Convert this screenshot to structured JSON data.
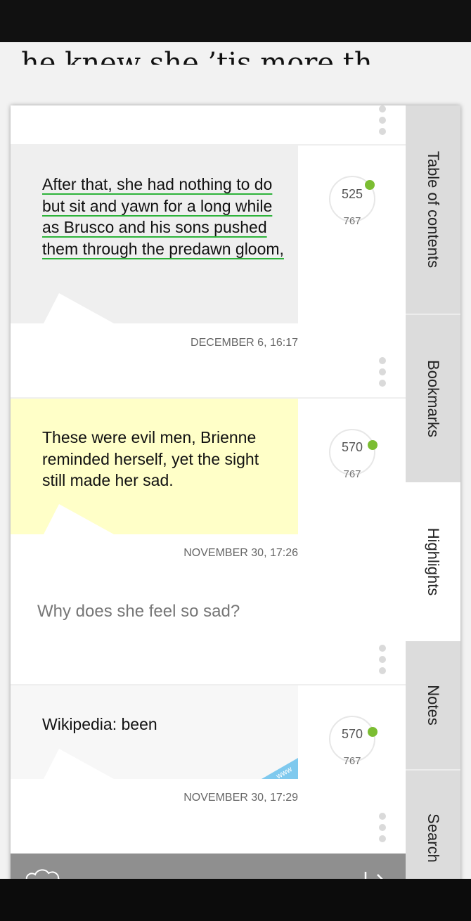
{
  "book_text_behind": "he knew she ’tis more th",
  "highlights": [
    {
      "text": "After that, she had nothing to do but sit and yawn for a long while as Brusco and his sons pushed them through the predawn gloom,",
      "style": "underline",
      "page": "525",
      "total": "767",
      "date": "DECEMBER 6, 16:17"
    },
    {
      "text": "These were evil men, Brienne reminded herself, yet the sight still made her sad.",
      "style": "yellow",
      "page": "570",
      "total": "767",
      "date": "NOVEMBER 30, 17:26",
      "note": "Why does she feel so sad?"
    },
    {
      "text": "Wikipedia: been",
      "style": "wiki",
      "page": "570",
      "total": "767",
      "date": "NOVEMBER 30, 17:29",
      "corner_label": "www"
    }
  ],
  "tabs": [
    {
      "label": "Table of contents",
      "active": false
    },
    {
      "label": "Bookmarks",
      "active": false
    },
    {
      "label": "Highlights",
      "active": true
    },
    {
      "label": "Notes",
      "active": false
    },
    {
      "label": "Search",
      "active": false
    }
  ],
  "toolbar": {
    "sync_icon": "cloud-sync-icon",
    "close_icon": "arrow-to-edge-icon"
  },
  "colors": {
    "yellow_highlight": "#ffffc8",
    "underline": "#2db33a",
    "progress_dot": "#7bbd32",
    "toolbar": "#8f8f8f",
    "wiki_corner": "#7fc9ee"
  }
}
